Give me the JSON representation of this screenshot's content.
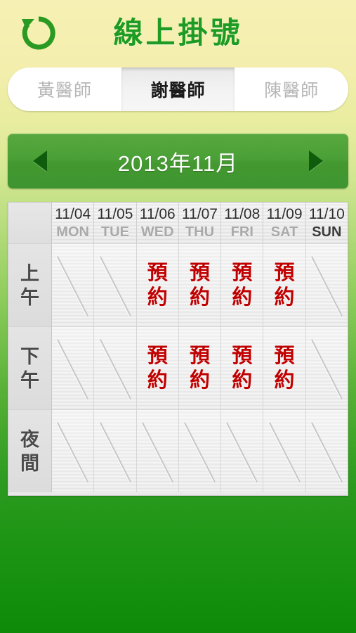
{
  "header": {
    "back_icon": "undo-arrow-icon",
    "title": "線上掛號",
    "title_color": "#1d9b22"
  },
  "tabs": [
    {
      "label": "黃醫師",
      "active": false
    },
    {
      "label": "謝醫師",
      "active": true
    },
    {
      "label": "陳醫師",
      "active": false
    }
  ],
  "month_nav": {
    "prev_icon": "triangle-left-icon",
    "next_icon": "triangle-right-icon",
    "label": "2013年11月",
    "bar_color": "#45992f"
  },
  "calendar": {
    "corner_label": "",
    "columns": [
      {
        "date": "11/04",
        "dow": "MON",
        "highlight": false
      },
      {
        "date": "11/05",
        "dow": "TUE",
        "highlight": false
      },
      {
        "date": "11/06",
        "dow": "WED",
        "highlight": false
      },
      {
        "date": "11/07",
        "dow": "THU",
        "highlight": false
      },
      {
        "date": "11/08",
        "dow": "FRI",
        "highlight": false
      },
      {
        "date": "11/09",
        "dow": "SAT",
        "highlight": false
      },
      {
        "date": "11/10",
        "dow": "SUN",
        "highlight": true
      }
    ],
    "rows": [
      {
        "label_top": "上",
        "label_bottom": "午",
        "cells": [
          "",
          "",
          "預約",
          "預約",
          "預約",
          "預約",
          ""
        ]
      },
      {
        "label_top": "下",
        "label_bottom": "午",
        "cells": [
          "",
          "",
          "預約",
          "預約",
          "預約",
          "預約",
          ""
        ]
      },
      {
        "label_top": "夜",
        "label_bottom": "間",
        "cells": [
          "",
          "",
          "",
          "",
          "",
          "",
          ""
        ]
      }
    ],
    "booking_text": "預約",
    "booking_color": "#c00000"
  }
}
